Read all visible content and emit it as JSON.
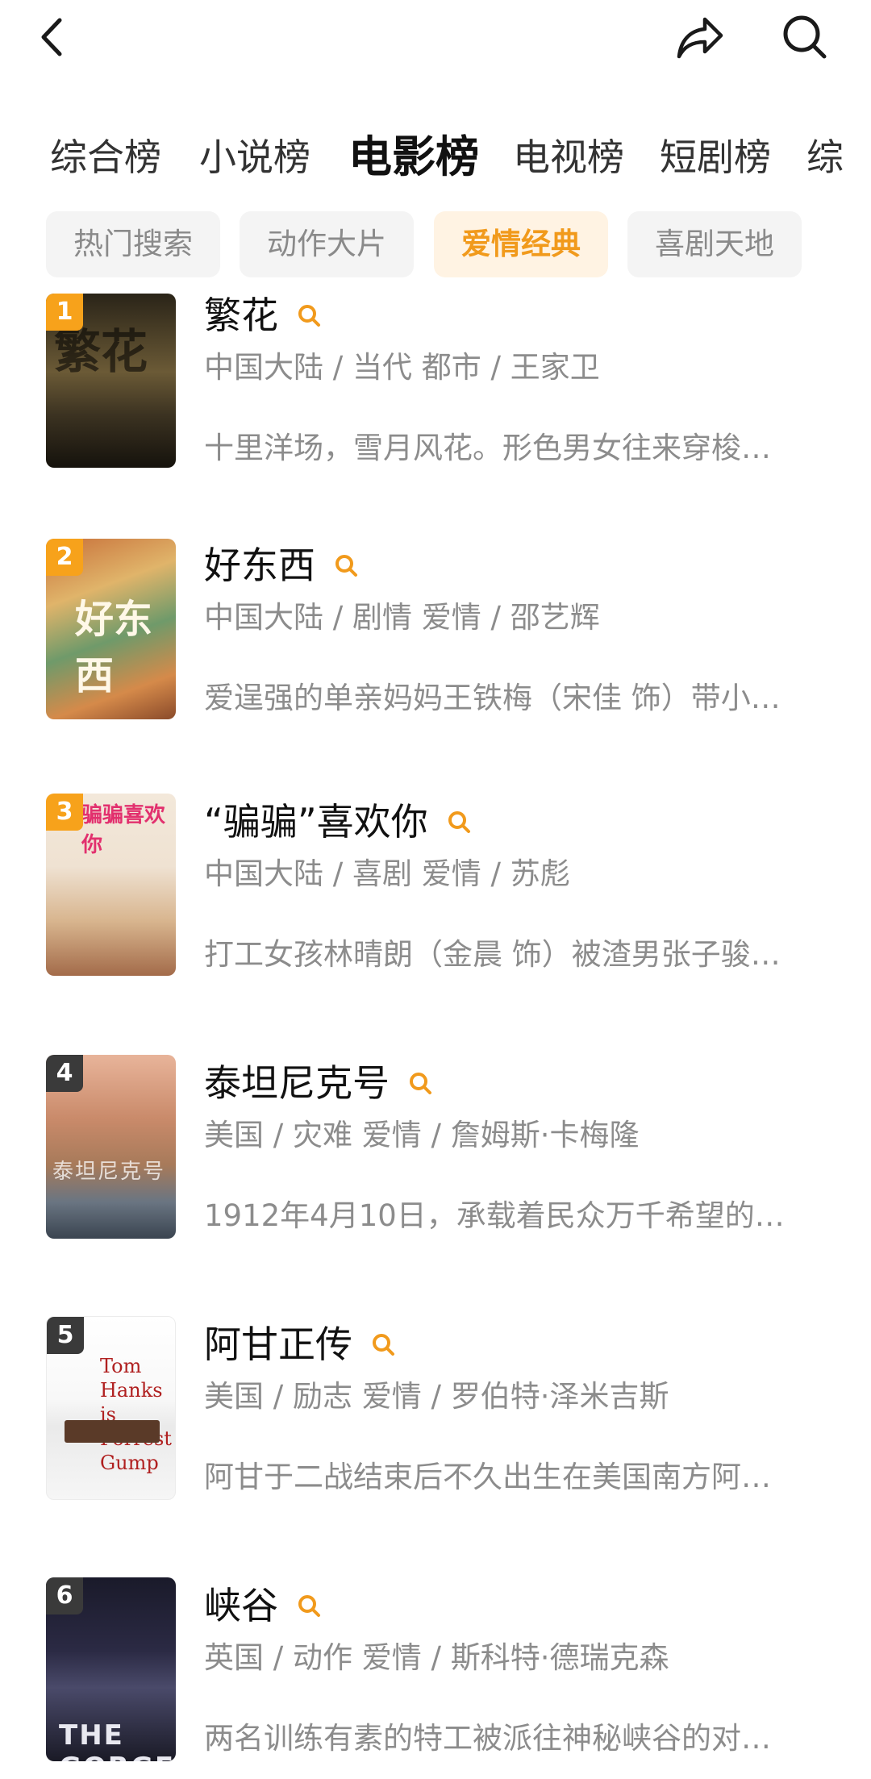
{
  "header": {
    "back_icon": "chevron-left-icon",
    "share_icon": "share-arrow-icon",
    "search_icon": "search-icon"
  },
  "tabs": [
    {
      "label": "综合榜",
      "active": false
    },
    {
      "label": "小说榜",
      "active": false
    },
    {
      "label": "电影榜",
      "active": true
    },
    {
      "label": "电视榜",
      "active": false
    },
    {
      "label": "短剧榜",
      "active": false
    },
    {
      "label": "综",
      "active": false
    }
  ],
  "chips": [
    {
      "label": "热门搜索",
      "active": false
    },
    {
      "label": "动作大片",
      "active": false
    },
    {
      "label": "爱情经典",
      "active": true
    },
    {
      "label": "喜剧天地",
      "active": false
    }
  ],
  "colors": {
    "accent": "#f19a1c",
    "rank_top": "#f7a21b",
    "rank_other": "#3a3a3a"
  },
  "items": [
    {
      "rank": "1",
      "title": "繁花",
      "meta": "中国大陆 / 当代 都市 / 王家卫",
      "desc": "十里洋场，雪月风花。形色男女往来穿梭…",
      "poster_text": "繁花"
    },
    {
      "rank": "2",
      "title": "好东西",
      "meta": "中国大陆 / 剧情 爱情 / 邵艺辉",
      "desc": "爱逞强的单亲妈妈王铁梅（宋佳 饰）带小…",
      "poster_text": "好东西"
    },
    {
      "rank": "3",
      "title": "“骗骗”喜欢你",
      "meta": "中国大陆 / 喜剧 爱情 / 苏彪",
      "desc": "打工女孩林晴朗（金晨 饰）被渣男张子骏…",
      "poster_text": "骗骗喜欢你"
    },
    {
      "rank": "4",
      "title": "泰坦尼克号",
      "meta": "美国 / 灾难 爱情 / 詹姆斯·卡梅隆",
      "desc": "1912年4月10日，承载着民众万千希望的…",
      "poster_text": "泰坦尼克号"
    },
    {
      "rank": "5",
      "title": "阿甘正传",
      "meta": "美国 / 励志 爱情 / 罗伯特·泽米吉斯",
      "desc": "阿甘于二战结束后不久出生在美国南方阿…",
      "poster_text": "Tom Hanks is Forrest Gump"
    },
    {
      "rank": "6",
      "title": "峡谷",
      "meta": "英国 / 动作 爱情 / 斯科特·德瑞克森",
      "desc": "两名训练有素的特工被派往神秘峡谷的对…",
      "poster_text": "THE GORGE"
    }
  ]
}
